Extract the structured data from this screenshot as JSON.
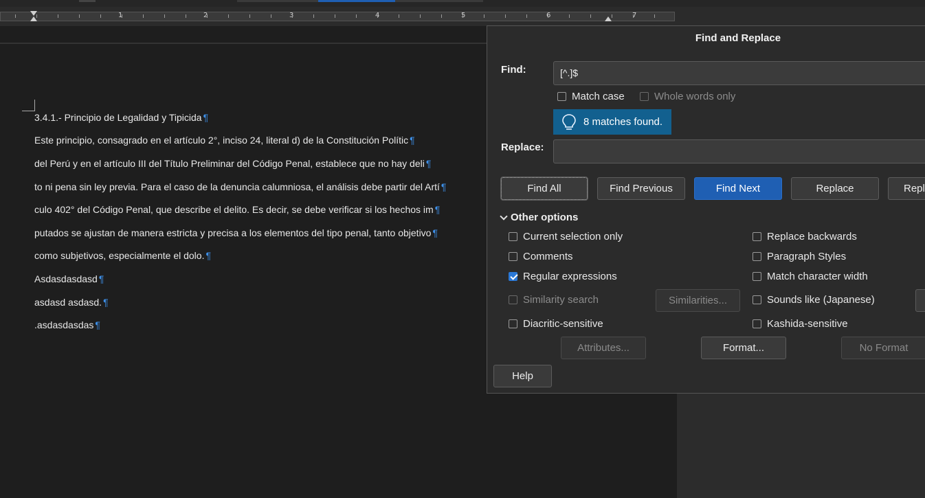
{
  "ruler": {
    "numbers": [
      "1",
      "2",
      "3",
      "4",
      "5",
      "6",
      "7"
    ]
  },
  "document": {
    "lines": [
      "3.4.1.- Principio de Legalidad y Tipicida",
      "Este principio, consagrado en el artículo 2°, inciso 24, literal d) de la Constitución Polític",
      "del Perú y en el artículo III del Título Preliminar del Código Penal, establece que no hay deli",
      "to ni pena sin ley previa. Para el caso de la denuncia calumniosa, el análisis debe partir del Artí",
      "culo 402° del Código Penal, que describe el delito. Es decir, se debe verificar si los hechos im",
      "putados se ajustan de manera estricta y precisa a los elementos del tipo penal, tanto objetivo",
      "como subjetivos, especialmente el dolo.",
      "Asdasdasdasd",
      "asdasd  asdasd.",
      ".asdasdasdas"
    ],
    "pilcrow": "¶"
  },
  "dialog": {
    "title": "Find and Replace",
    "find_label": "Find:",
    "find_value": "[^.]$",
    "match_case": "Match case",
    "whole_words": "Whole words only",
    "matches_msg": "8 matches found.",
    "replace_label": "Replace:",
    "replace_value": "",
    "buttons": {
      "find_all": "Find All",
      "find_previous": "Find Previous",
      "find_next": "Find Next",
      "replace": "Replace",
      "replace_all": "Repl"
    },
    "other_options": "Other options",
    "options": {
      "current_selection": "Current selection only",
      "comments": "Comments",
      "regular_expressions": "Regular expressions",
      "similarity_search": "Similarity search",
      "diacritic_sensitive": "Diacritic-sensitive",
      "replace_backwards": "Replace backwards",
      "paragraph_styles": "Paragraph Styles",
      "match_char_width": "Match character width",
      "sounds_like": "Sounds like (Japanese)",
      "kashida_sensitive": "Kashida-sensitive"
    },
    "similarities_btn": "Similarities...",
    "attributes_btn": "Attributes...",
    "format_btn": "Format...",
    "no_format_btn": "No Format",
    "help_btn": "Help"
  },
  "colors": {
    "accent": "#1f5fb3",
    "info": "#12608f",
    "pilcrow": "#3d8ee6"
  },
  "icons": {
    "info": "lightbulb-icon",
    "section": "chevron-down-icon"
  }
}
